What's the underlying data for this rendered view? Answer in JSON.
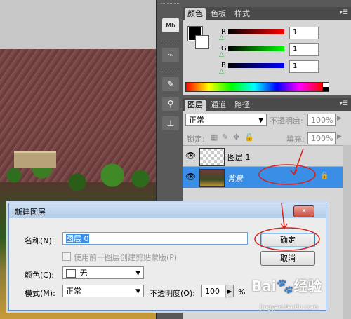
{
  "panels": {
    "color": {
      "tabs": [
        "颜色",
        "色板",
        "样式"
      ],
      "r_label": "R",
      "g_label": "G",
      "b_label": "B",
      "r_value": "1",
      "g_value": "1",
      "b_value": "1"
    },
    "layers": {
      "tabs": [
        "图层",
        "通道",
        "路径"
      ],
      "blend_mode": "正常",
      "opacity_label": "不透明度:",
      "opacity_value": "100%",
      "lock_label": "锁定:",
      "fill_label": "填充:",
      "fill_value": "100%",
      "items": [
        {
          "name": "图层 1"
        },
        {
          "name": "背景"
        }
      ]
    }
  },
  "dialog": {
    "title": "新建图层",
    "name_label": "名称(N):",
    "name_value": "图层 0",
    "clip_label": "使用前一图层创建剪贴蒙版(P)",
    "color_label": "颜色(C):",
    "color_value": "无",
    "mode_label": "模式(M):",
    "mode_value": "正常",
    "opacity_label": "不透明度(O):",
    "opacity_value": "100",
    "percent": "%",
    "ok_label": "确定",
    "cancel_label": "取消",
    "close_label": "x"
  },
  "watermark": {
    "brand": "Bai",
    "brand2": "经验",
    "url": "jingyan.baidu.com"
  },
  "colors": {
    "selection": "#3a8ee6",
    "annotation": "#d9201a"
  }
}
